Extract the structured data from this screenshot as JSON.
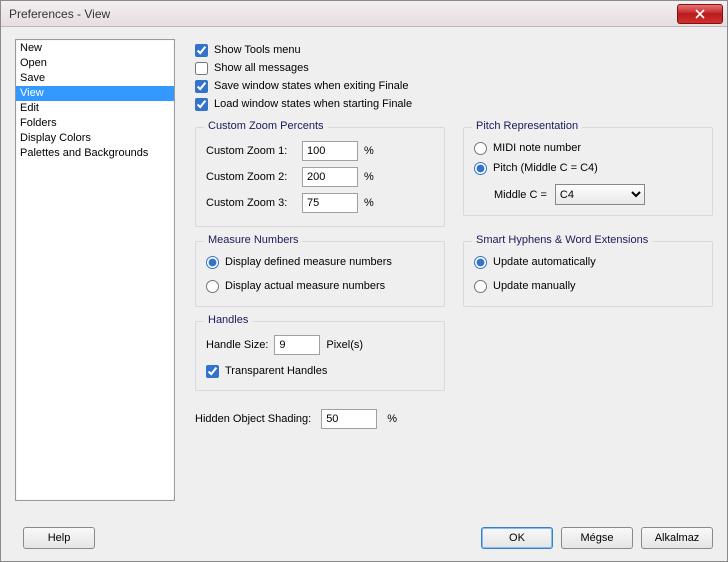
{
  "window": {
    "title": "Preferences - View"
  },
  "sidebar": {
    "items": [
      {
        "label": "New"
      },
      {
        "label": "Open"
      },
      {
        "label": "Save"
      },
      {
        "label": "View",
        "selected": true
      },
      {
        "label": "Edit"
      },
      {
        "label": "Folders"
      },
      {
        "label": "Display Colors"
      },
      {
        "label": "Palettes and Backgrounds"
      }
    ]
  },
  "checks": {
    "show_tools_menu": {
      "label": "Show Tools menu",
      "checked": true
    },
    "show_all_messages": {
      "label": "Show all messages",
      "checked": false
    },
    "save_window_states_exit": {
      "label": "Save window states when exiting Finale",
      "checked": true
    },
    "load_window_states_start": {
      "label": "Load window states when starting Finale",
      "checked": true
    }
  },
  "custom_zoom": {
    "title": "Custom Zoom Percents",
    "rows": [
      {
        "label": "Custom Zoom 1:",
        "value": "100",
        "unit": "%"
      },
      {
        "label": "Custom Zoom 2:",
        "value": "200",
        "unit": "%"
      },
      {
        "label": "Custom Zoom 3:",
        "value": "75",
        "unit": "%"
      }
    ]
  },
  "pitch": {
    "title": "Pitch Representation",
    "midi": {
      "label": "MIDI note number",
      "selected": false
    },
    "pitch": {
      "label": "Pitch (Middle C = C4)",
      "selected": true
    },
    "middle_c_label": "Middle C =",
    "middle_c_value": "C4"
  },
  "measure_numbers": {
    "title": "Measure Numbers",
    "defined": {
      "label": "Display defined measure numbers",
      "selected": true
    },
    "actual": {
      "label": "Display actual measure numbers",
      "selected": false
    }
  },
  "smart_hyphens": {
    "title": "Smart Hyphens & Word Extensions",
    "auto": {
      "label": "Update automatically",
      "selected": true
    },
    "manual": {
      "label": "Update manually",
      "selected": false
    }
  },
  "handles": {
    "title": "Handles",
    "size_label": "Handle Size:",
    "size_value": "9",
    "size_unit": "Pixel(s)",
    "transparent": {
      "label": "Transparent Handles",
      "checked": true
    }
  },
  "hidden_shading": {
    "label": "Hidden Object Shading:",
    "value": "50",
    "unit": "%"
  },
  "buttons": {
    "help": "Help",
    "ok": "OK",
    "cancel": "Mégse",
    "apply": "Alkalmaz"
  }
}
